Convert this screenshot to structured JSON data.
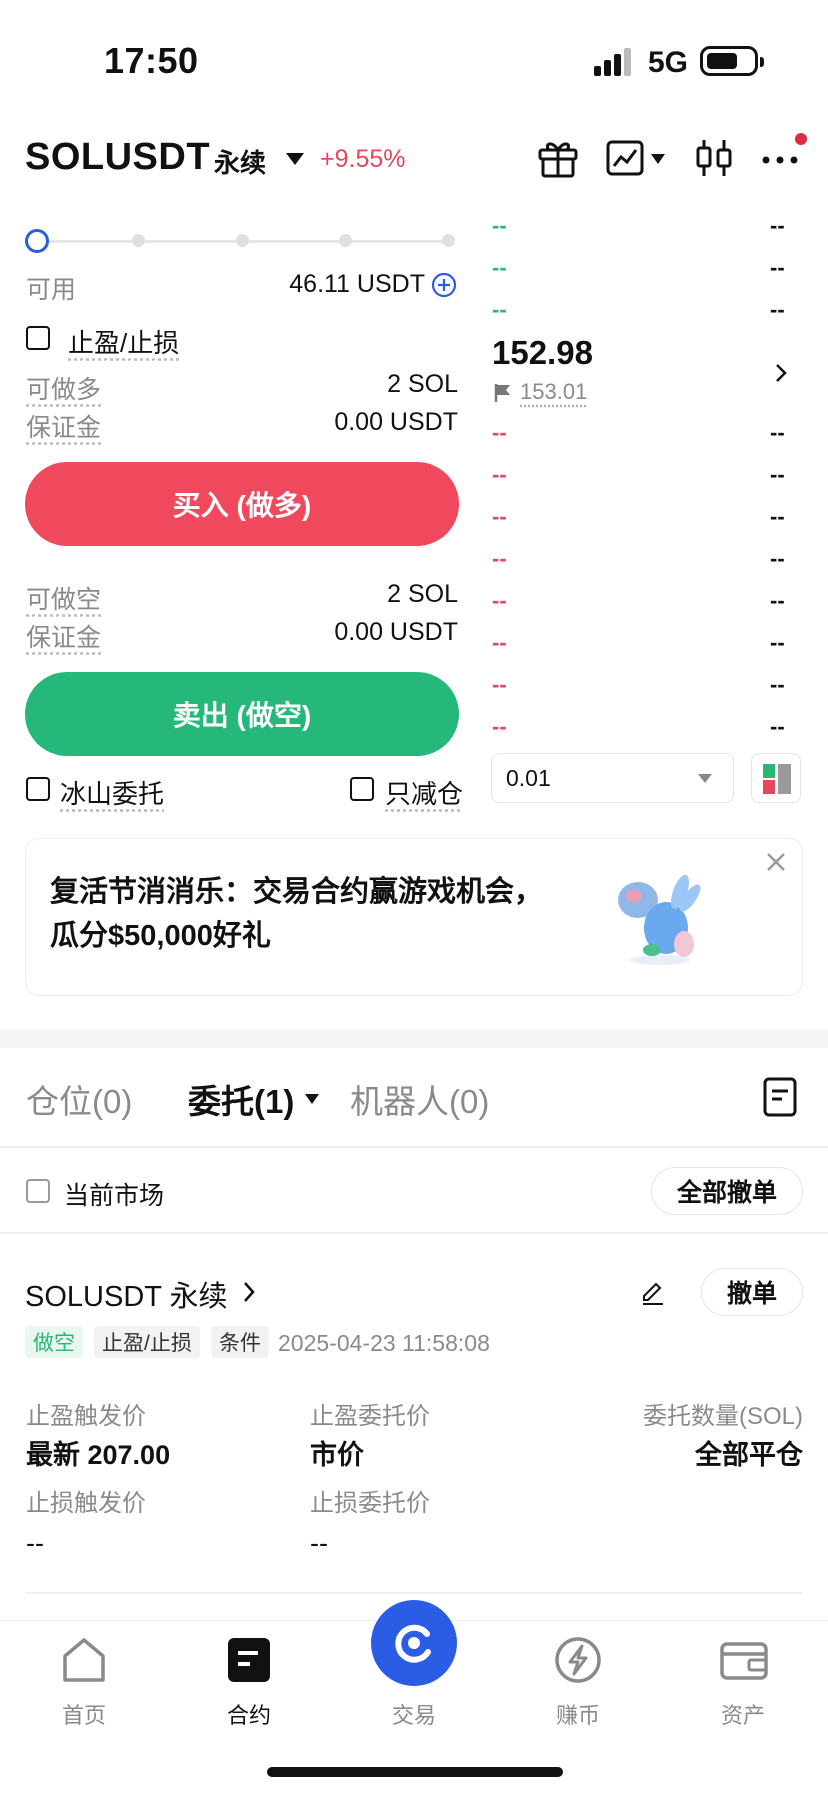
{
  "status_bar": {
    "time": "17:50",
    "network": "5G"
  },
  "header": {
    "symbol": "SOLUSDT",
    "contract_type": "永续",
    "change": "+9.55%"
  },
  "trade_form": {
    "available_label": "可用",
    "available_value": "46.11 USDT",
    "tpsl_label": "止盈/止损",
    "long_max_label": "可做多",
    "long_max_value": "2 SOL",
    "long_margin_label": "保证金",
    "long_margin_value": "0.00 USDT",
    "buy_button": "买入 (做多)",
    "short_max_label": "可做空",
    "short_max_value": "2 SOL",
    "short_margin_label": "保证金",
    "short_margin_value": "0.00 USDT",
    "sell_button": "卖出 (做空)",
    "iceberg_label": "冰山委托",
    "reduce_only_label": "只减仓"
  },
  "order_book": {
    "placeholder": "--",
    "last_price": "152.98",
    "mark_price": "153.01",
    "precision": "0.01",
    "asks_count": 3,
    "bids_count": 8,
    "colors": {
      "ask": "#2bb673",
      "bid": "#e5475f"
    }
  },
  "promo": {
    "text": "复活节消消乐：交易合约赢游戏机会，瓜分$50,000好礼"
  },
  "tabs": [
    {
      "label": "仓位(0)"
    },
    {
      "label": "委托(1)"
    },
    {
      "label": "机器人(0)"
    }
  ],
  "filter": {
    "current_market_label": "当前市场",
    "cancel_all_button": "全部撤单"
  },
  "order": {
    "title": "SOLUSDT 永续",
    "cancel_button": "撤单",
    "tags": [
      "做空",
      "止盈/止损",
      "条件"
    ],
    "time": "2025-04-23 11:58:08",
    "tp_trigger_label": "止盈触发价",
    "tp_trigger_value": "最新 207.00",
    "tp_price_label": "止盈委托价",
    "tp_price_value": "市价",
    "qty_label": "委托数量(SOL)",
    "qty_value": "全部平仓",
    "sl_trigger_label": "止损触发价",
    "sl_trigger_value": "--",
    "sl_price_label": "止损委托价",
    "sl_price_value": "--"
  },
  "bottom_nav": [
    {
      "label": "首页",
      "icon": "home-icon"
    },
    {
      "label": "合约",
      "icon": "futures-icon"
    },
    {
      "label": "交易",
      "icon": "trade-icon"
    },
    {
      "label": "赚币",
      "icon": "earn-icon"
    },
    {
      "label": "资产",
      "icon": "wallet-icon"
    }
  ],
  "colors": {
    "accent": "#2a5ce5",
    "buy": "#f0495d",
    "sell": "#26b87a"
  }
}
